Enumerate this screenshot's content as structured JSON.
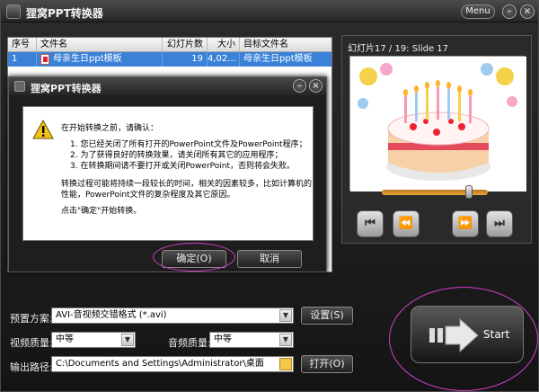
{
  "window": {
    "title": "狸窝PPT转换器",
    "menu_label": "Menu",
    "minimize_glyph": "–",
    "close_glyph": "×"
  },
  "file_table": {
    "headers": [
      "序号",
      "文件名",
      "幻灯片数",
      "大小",
      "目标文件名"
    ],
    "rows": [
      {
        "index": "1",
        "filename": "母亲生日ppt模板",
        "slides": "19",
        "size": "4,02...",
        "target": "母亲生日ppt模板"
      }
    ]
  },
  "preview": {
    "slide_label": "幻灯片17 / 19: Slide 17",
    "seek_fraction": 0.82,
    "buttons": {
      "prev": "⏮",
      "rewind": "⏪",
      "forward": "⏩",
      "next": "⏭"
    }
  },
  "dialog": {
    "title": "狸窝PPT转换器",
    "intro": "在开始转换之前，请确认：",
    "items": [
      "1.   您已经关闭了所有打开的PowerPoint文件及PowerPoint程序；",
      "2.   为了获得良好的转换效果，请关闭所有其它的应用程序；",
      "3.   在转换期间请不要打开或关闭PowerPoint，否则将会失败。"
    ],
    "note": "转换过程可能将持续一段较长的时间，相关的因素较多，比如计算机的性能，PowerPoint文件的复杂程度及其它原因。",
    "prompt": "点击\"确定\"开始转换。",
    "ok_label": "确定(O)",
    "cancel_label": "取消"
  },
  "settings": {
    "preset_label": "预置方案:",
    "preset_value": "AVI-音视频交错格式 (*.avi)",
    "settings_button": "设置(S)",
    "video_quality_label": "视频质量:",
    "video_quality_value": "中等",
    "audio_quality_label": "音频质量:",
    "audio_quality_value": "中等",
    "output_label": "输出路径:",
    "output_value": "C:\\Documents and Settings\\Administrator\\桌面",
    "open_button": "打开(O)",
    "start_label": "Start"
  },
  "colors": {
    "selection_blue": "#3a82d8",
    "highlight_magenta": "#d03fc8",
    "seek_orange": "#e9a63b"
  }
}
